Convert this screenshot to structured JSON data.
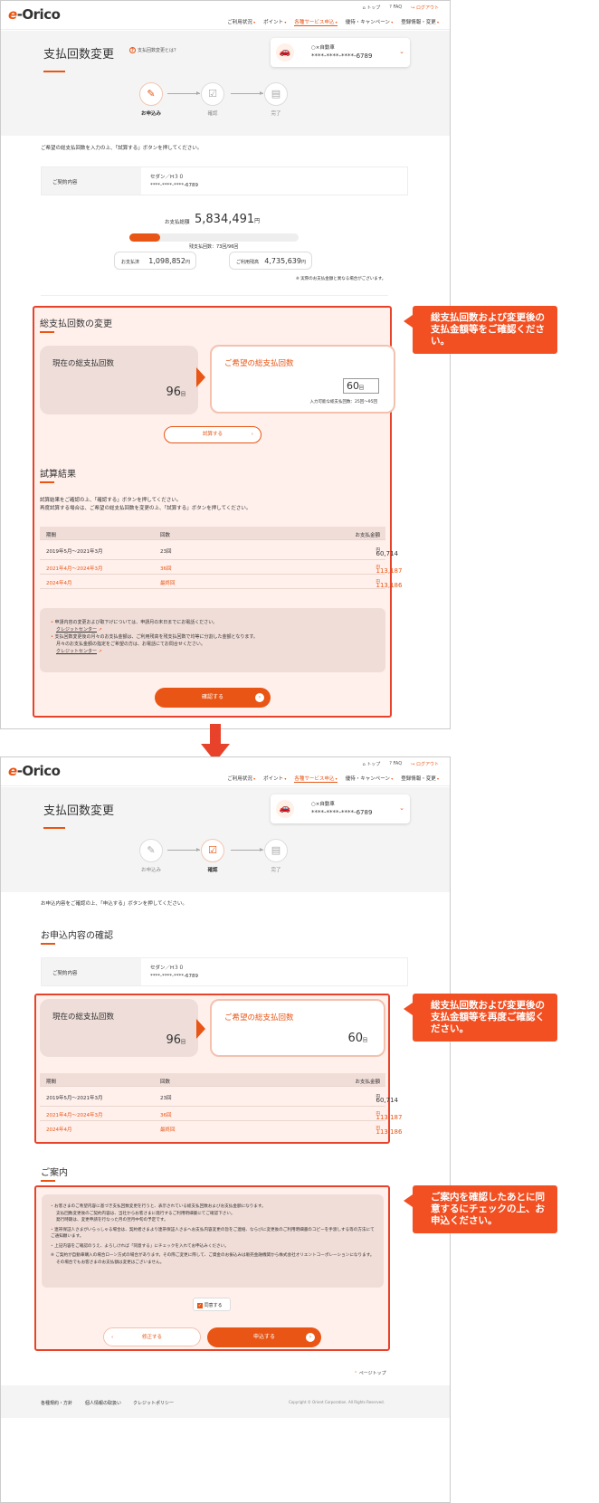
{
  "header": {
    "logo_e": "e",
    "logo_rest": "-Orico",
    "links": [
      "トップ",
      "FAQ",
      "ログアウト"
    ],
    "nav": [
      "ご利用状況",
      "ポイント",
      "各種サービス申込",
      "優待・キャンペーン",
      "登録情報・変更"
    ]
  },
  "page": {
    "title": "支払回数変更",
    "help": "支払回数変更とは？"
  },
  "card": {
    "type": "○×自動車",
    "number": "****-****-****-6789"
  },
  "steps": [
    "お申込み",
    "確認",
    "完了"
  ],
  "s1": {
    "instruction": "ご希望の総支払回数を入力の上、「試算する」ボタンを押してください。",
    "contract_label": "ご契約内容",
    "contract_name": "セダン／H３０",
    "contract_no": "****-****-****-6789",
    "total_label": "お支払総額",
    "total_value": "5,834,491",
    "total_unit": "円",
    "progress_label": "残支払回数：73回/96回",
    "progress_fraction": 0.18,
    "paid_label": "お支払済",
    "paid_value": "1,098,852",
    "used_label": "ご利用残高",
    "used_value": "4,735,639",
    "yen": "円",
    "footnote": "※ 実際のお支払金額と異なる場合がございます。",
    "change_title": "総支払回数の変更",
    "cur_label": "現在の総支払回数",
    "cur_value": "96",
    "times": "回",
    "new_label": "ご希望の総支払回数",
    "new_value": "60",
    "range": "入力可能な総支払回数：25回〜95回",
    "calc_btn": "試算する",
    "result_title": "試算結果",
    "result_text1": "試算結果をご確認の上、「確認する」ボタンを押してください。",
    "result_text2": "再度試算する場合は、ご希望の総支払回数を変更の上、「試算する」ボタンを押してください。",
    "note1": "申請内容の変更および取下げについては、申請月の末日までにお電話ください。",
    "note_link": "クレジットセンター",
    "note2": "支払回数変更後の月々のお支払金額は、ご利用残高を残支払回数で均等に分割した金額となります。",
    "note3": "月々のお支払金額の指定をご希望の方は、お電話にてお問合せください。",
    "confirm_btn": "確認する"
  },
  "table": {
    "headers": [
      "期間",
      "回数",
      "お支払金額"
    ],
    "rows": [
      {
        "period": "2019年5月〜2021年3月",
        "count": "23回",
        "amount": "60,714"
      },
      {
        "period": "2021年4月〜2024年3月",
        "count": "36回",
        "amount": "113,187"
      },
      {
        "period": "2024年4月",
        "count": "最終回",
        "amount": "113,186"
      }
    ],
    "yen": "円"
  },
  "s2": {
    "instruction": "お申込内容をご確認の上、「申込する」ボタンを押してください。",
    "confirm_title": "お申込内容の確認",
    "guide_title": "ご案内",
    "g1": "お客さまのご希望内容に基づき支払回数変更を行うと、表示されている総支払回数およびお支払金額になります。",
    "g1b": "支払回数変更後のご契約内容は、当社からお客さまに発行するご利用明細書にてご確認下さい。",
    "g1c": "発行時期は、変更申請を行なった月の翌月中旬の予定です。",
    "g2": "連帯保証人さまがいらっしゃる場合は、契約者さまより連帯保証人さまへお支払内容変更の旨をご連絡、ならびに変更後のご利用明細書のコピーを手渡しする等の方法にてご通知願います。",
    "g3": "上記内容をご確認のうえ、よろしければ「同意する」にチェックを入れてお申込みください。",
    "g4": "※ ご契約が自動車購入の場合ローン方式の場合があります。その際ご変更に際して、ご資金のお振込みは販売金融機関から株式会社オリエントコーポレーションになります。",
    "g4b": "その場合でもお客さまのお支払額は変更はございません。",
    "agree": "同意する",
    "back_btn": "修正する",
    "apply_btn": "申込する",
    "pagetop": "ページトップ",
    "footer_links": [
      "各種規約・方針",
      "個人情報の取扱い",
      "クレジットポリシー"
    ],
    "copyright": "Copyright © Orient Corporation. All Rights Reserved."
  },
  "callouts": {
    "c1": "総支払回数および変更後の支払金額等をご確認ください。",
    "c2": "総支払回数および変更後の支払金額等を再度ご確認ください。",
    "c3": "ご案内を確認したあとに同意するにチェックの上、お申込ください。"
  },
  "colors": {
    "accent": "#e95514",
    "callout": "#f25022"
  }
}
